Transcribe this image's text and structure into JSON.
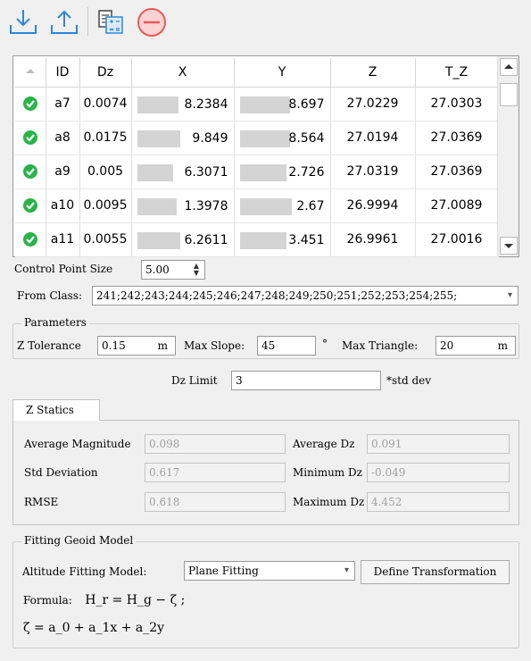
{
  "toolbar": {
    "icons": [
      "import-icon",
      "export-icon",
      "calculator-icon",
      "remove-icon"
    ]
  },
  "table": {
    "columns": [
      "",
      "ID",
      "Dz",
      "X",
      "Y",
      "Z",
      "T_Z"
    ],
    "rows": [
      {
        "id": "a7",
        "dz": "0.0074",
        "x": "8.2384",
        "y": "8.697",
        "z": "27.0229",
        "tz": "27.0303"
      },
      {
        "id": "a8",
        "dz": "0.0175",
        "x": "9.849",
        "y": "8.564",
        "z": "27.0194",
        "tz": "27.0369"
      },
      {
        "id": "a9",
        "dz": "0.005",
        "x": "6.3071",
        "y": "2.726",
        "z": "27.0319",
        "tz": "27.0369"
      },
      {
        "id": "a10",
        "dz": "0.0095",
        "x": "1.3978",
        "y": "2.67",
        "z": "26.9994",
        "tz": "27.0089"
      },
      {
        "id": "a11",
        "dz": "0.0055",
        "x": "6.2611",
        "y": "3.451",
        "z": "26.9961",
        "tz": "27.0016"
      }
    ],
    "status_color": "#2bb34a"
  },
  "control_point_size": {
    "label": "Control Point Size",
    "value": "5.00"
  },
  "from_class": {
    "label": "From Class:",
    "value": "241;242;243;244;245;246;247;248;249;250;251;252;253;254;255;"
  },
  "parameters": {
    "title": "Parameters",
    "z_tolerance": {
      "label": "Z Tolerance",
      "value": "0.15",
      "unit": "m"
    },
    "max_slope": {
      "label": "Max Slope:",
      "value": "45",
      "unit": "°"
    },
    "max_triangle": {
      "label": "Max Triangle:",
      "value": "20",
      "unit": "m"
    }
  },
  "dz_limit": {
    "label": "Dz Limit",
    "value": "3",
    "suffix": "*std dev"
  },
  "statics": {
    "tab": "Z Statics",
    "average_magnitude": {
      "label": "Average Magnitude",
      "value": "0.098"
    },
    "std_deviation": {
      "label": "Std Deviation",
      "value": "0.617"
    },
    "rmse": {
      "label": "RMSE",
      "value": "0.618"
    },
    "average_dz": {
      "label": "Average Dz",
      "value": "0.091"
    },
    "minimum_dz": {
      "label": "Minimum Dz",
      "value": "-0.049"
    },
    "maximum_dz": {
      "label": "Maximum Dz",
      "value": "4.452"
    }
  },
  "fitting": {
    "title": "Fitting Geoid Model",
    "model_label": "Altitude Fitting Model:",
    "model_value": "Plane Fitting",
    "define_button": "Define Transformation",
    "formula_label": "Formula:",
    "formula1": "H_r = H_g − ζ ;",
    "formula2": "ζ = a_0 + a_1x + a_2y"
  }
}
